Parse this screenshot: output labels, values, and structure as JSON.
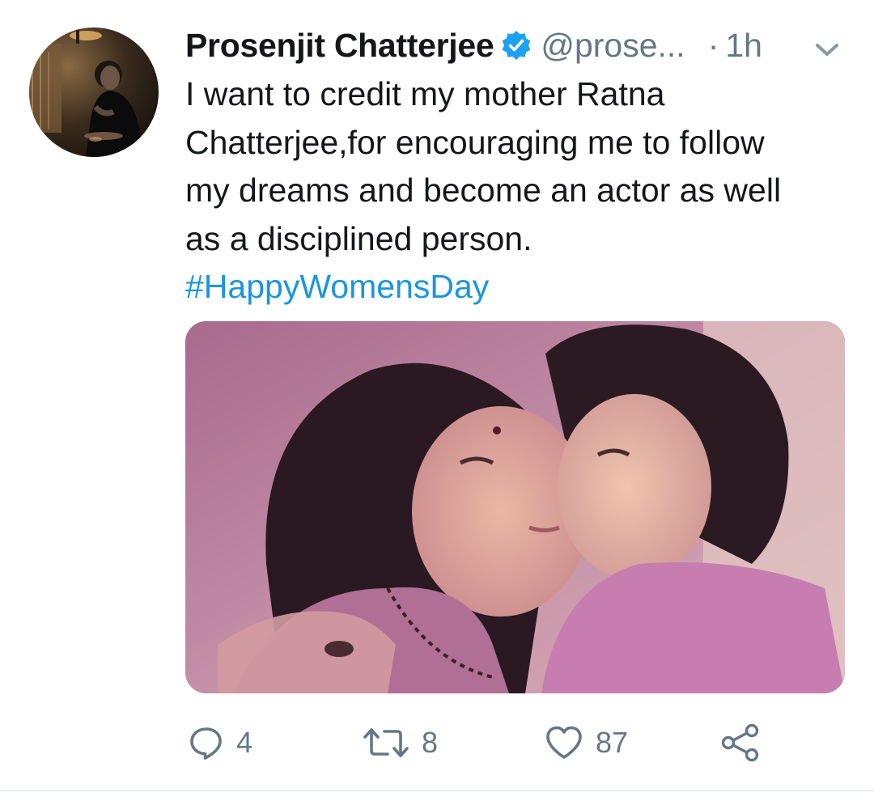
{
  "tweet": {
    "author_name": "Prosenjit Chatterjee",
    "verified": true,
    "handle": "@prose...",
    "separator": "·",
    "time": "1h",
    "text_lines": [
      "I want to credit my mother Ratna",
      "Chatterjee,for encouraging me to follow",
      "my dreams and become an actor as well",
      "as a disciplined person."
    ],
    "hashtag": "#HappyWomensDay"
  },
  "actions": {
    "reply_count": "4",
    "retweet_count": "8",
    "like_count": "87"
  },
  "icons": {
    "reply": "reply-icon",
    "retweet": "retweet-icon",
    "like": "heart-icon",
    "share": "share-icon",
    "verified": "verified-badge-icon",
    "more": "chevron-down-icon"
  },
  "colors": {
    "text": "#14171a",
    "secondary": "#657786",
    "link": "#1b95e0",
    "verified": "#1da1f2",
    "divider": "#e6ecf0"
  }
}
